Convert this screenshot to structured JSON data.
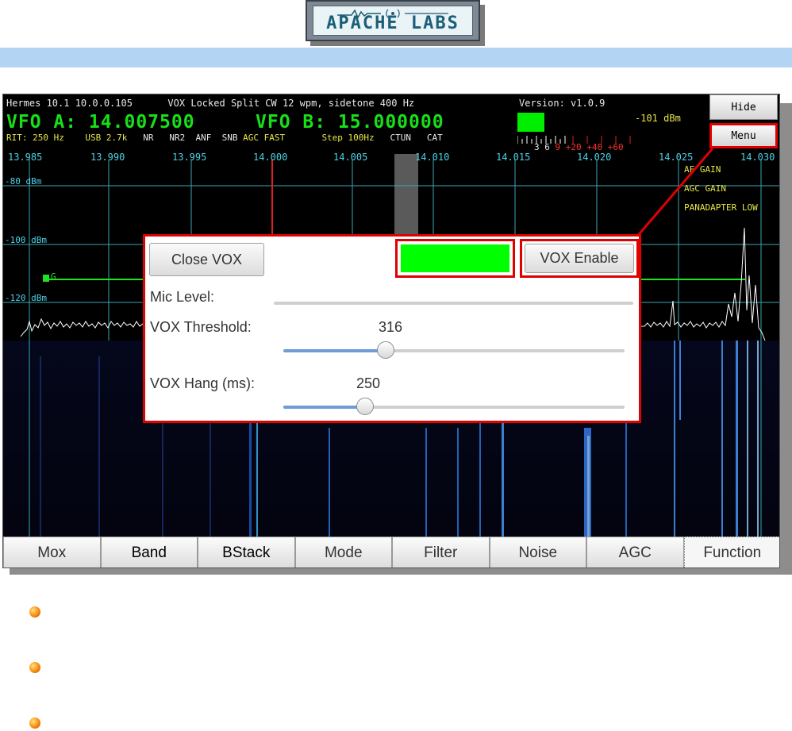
{
  "logo": {
    "text": "APACHE LABS"
  },
  "status": {
    "line1": "Hermes 10.1 10.0.0.105",
    "vox": "VOX",
    "locked": "Locked",
    "split": "Split",
    "cw": "CW 12 wpm, sidetone 400 Hz",
    "version": "Version: v1.0.9"
  },
  "vfo": {
    "a": "VFO A: 14.007500",
    "b": "VFO B: 15.000000",
    "dbm": "-101 dBm"
  },
  "info": {
    "rit": "RIT: 250 Hz",
    "mode": "USB 2.7k",
    "nr": "NR",
    "nr2": "NR2",
    "anf": "ANF",
    "snb": "SNB",
    "agc": "AGC FAST",
    "step": "Step 100Hz",
    "ctun": "CTUN",
    "cat": "CAT"
  },
  "smeter": {
    "white": "3  6",
    "red": "9 +20 +40 +60"
  },
  "freq_scale": [
    "13.985",
    "13.990",
    "13.995",
    "14.000",
    "14.005",
    "14.010",
    "14.015",
    "14.020",
    "14.025",
    "14.030"
  ],
  "dbm_labels": [
    "-80 dBm",
    "-100 dBm",
    "-120 dBm"
  ],
  "marker": "G",
  "right_labels": [
    "AF GAIN",
    "AGC GAIN",
    "PANADAPTER LOW"
  ],
  "side_buttons": {
    "hide": "Hide",
    "menu": "Menu"
  },
  "toolbar": [
    "Mox",
    "Band",
    "BStack",
    "Mode",
    "Filter",
    "Noise",
    "AGC",
    "Function"
  ],
  "vox_dialog": {
    "close": "Close VOX",
    "enable": "VOX Enable",
    "mic_label": "Mic Level:",
    "threshold_label": "VOX Threshold:",
    "threshold_value": "316",
    "threshold_fraction": 0.3,
    "hang_label": "VOX Hang (ms):",
    "hang_value": "250",
    "hang_fraction": 0.24,
    "indicator_color": "#00ff00"
  },
  "colors": {
    "accent_red": "#e00000",
    "vfo_green": "#18e018",
    "scale_cyan": "#4dd2e8"
  }
}
